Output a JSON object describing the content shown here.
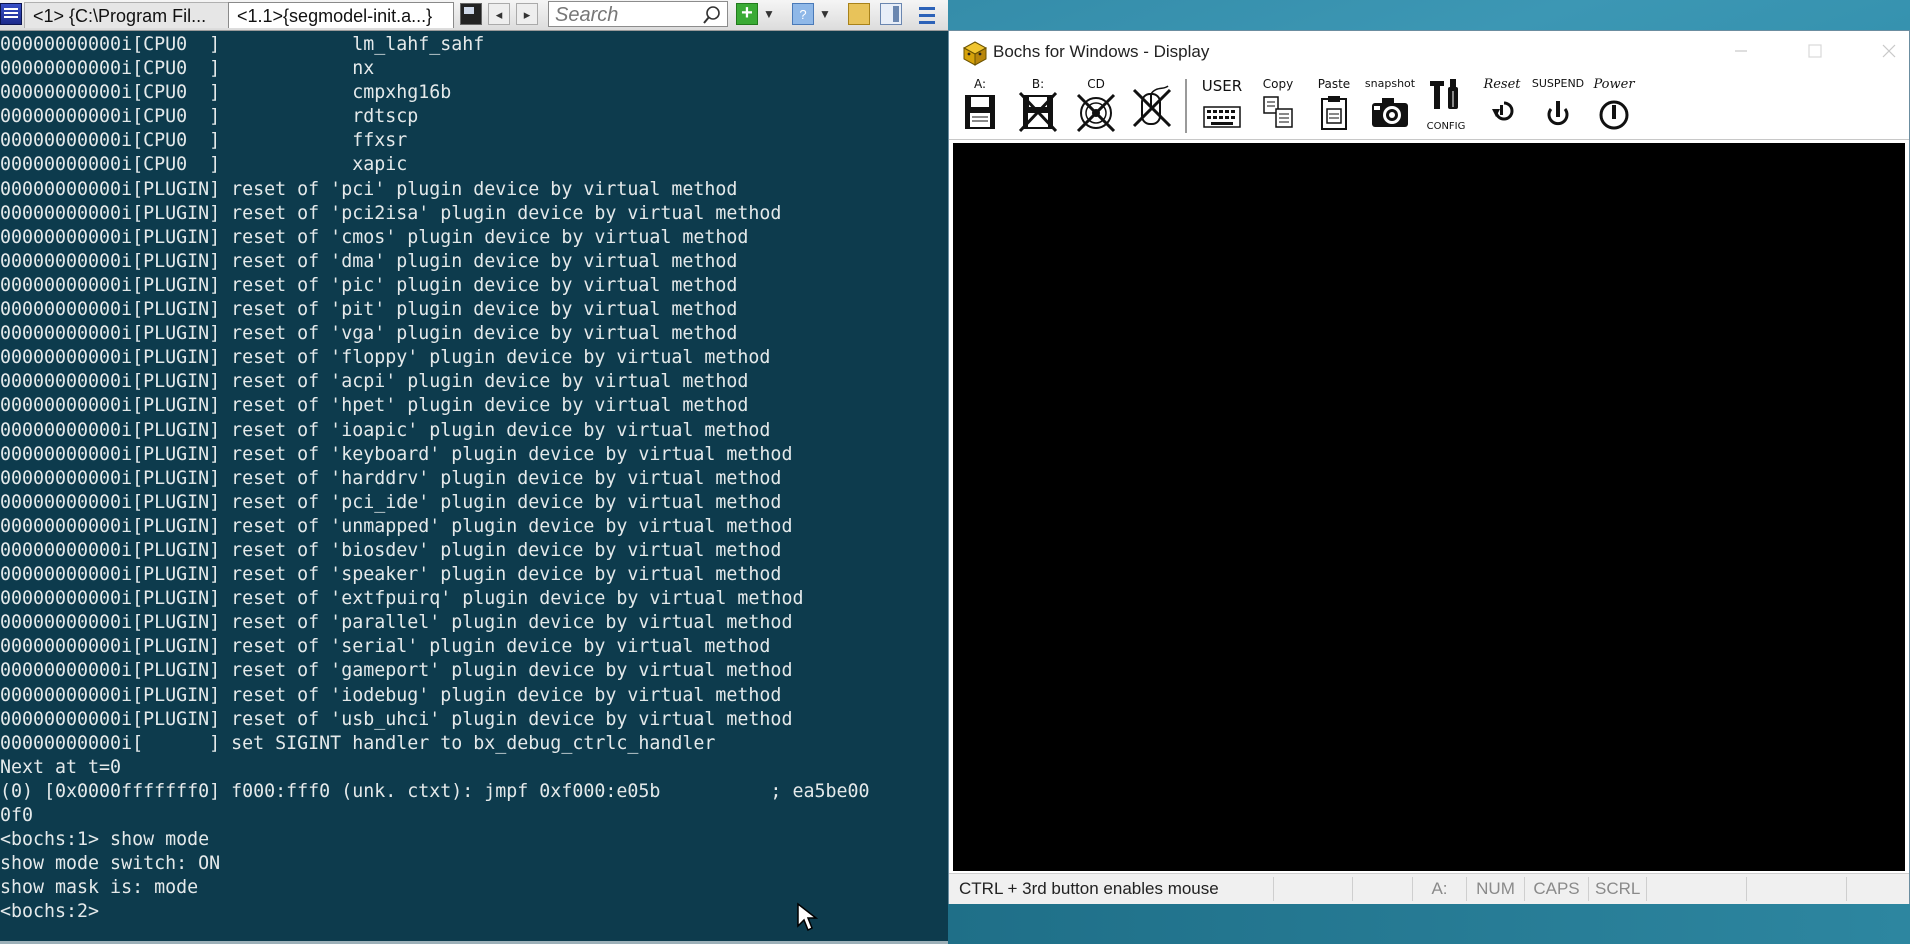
{
  "console": {
    "tabs": [
      {
        "label": "<1> {C:\\Program Fil..."
      },
      {
        "label": "<1.1>{segmodel-init.a...}"
      }
    ],
    "search": {
      "placeholder": "Search"
    },
    "lines": [
      "00000000000i[CPU0  ]            lm_lahf_sahf",
      "00000000000i[CPU0  ]            nx",
      "00000000000i[CPU0  ]            cmpxhg16b",
      "00000000000i[CPU0  ]            rdtscp",
      "00000000000i[CPU0  ]            ffxsr",
      "00000000000i[CPU0  ]            xapic",
      "00000000000i[PLUGIN] reset of 'pci' plugin device by virtual method",
      "00000000000i[PLUGIN] reset of 'pci2isa' plugin device by virtual method",
      "00000000000i[PLUGIN] reset of 'cmos' plugin device by virtual method",
      "00000000000i[PLUGIN] reset of 'dma' plugin device by virtual method",
      "00000000000i[PLUGIN] reset of 'pic' plugin device by virtual method",
      "00000000000i[PLUGIN] reset of 'pit' plugin device by virtual method",
      "00000000000i[PLUGIN] reset of 'vga' plugin device by virtual method",
      "00000000000i[PLUGIN] reset of 'floppy' plugin device by virtual method",
      "00000000000i[PLUGIN] reset of 'acpi' plugin device by virtual method",
      "00000000000i[PLUGIN] reset of 'hpet' plugin device by virtual method",
      "00000000000i[PLUGIN] reset of 'ioapic' plugin device by virtual method",
      "00000000000i[PLUGIN] reset of 'keyboard' plugin device by virtual method",
      "00000000000i[PLUGIN] reset of 'harddrv' plugin device by virtual method",
      "00000000000i[PLUGIN] reset of 'pci_ide' plugin device by virtual method",
      "00000000000i[PLUGIN] reset of 'unmapped' plugin device by virtual method",
      "00000000000i[PLUGIN] reset of 'biosdev' plugin device by virtual method",
      "00000000000i[PLUGIN] reset of 'speaker' plugin device by virtual method",
      "00000000000i[PLUGIN] reset of 'extfpuirq' plugin device by virtual method",
      "00000000000i[PLUGIN] reset of 'parallel' plugin device by virtual method",
      "00000000000i[PLUGIN] reset of 'serial' plugin device by virtual method",
      "00000000000i[PLUGIN] reset of 'gameport' plugin device by virtual method",
      "00000000000i[PLUGIN] reset of 'iodebug' plugin device by virtual method",
      "00000000000i[PLUGIN] reset of 'usb_uhci' plugin device by virtual method",
      "00000000000i[      ] set SIGINT handler to bx_debug_ctrlc_handler",
      "Next at t=0",
      "(0) [0x0000fffffff0] f000:fff0 (unk. ctxt): jmpf 0xf000:e05b          ; ea5be00",
      "0f0",
      "<bochs:1> show mode",
      "show mode switch: ON",
      "show mask is: mode",
      "<bochs:2>"
    ]
  },
  "bochs": {
    "title": "Bochs for Windows - Display",
    "toolbar": {
      "floppy_a": "A:",
      "floppy_b": "B:",
      "cdrom": "CD",
      "user": "USER",
      "copy": "Copy",
      "paste": "Paste",
      "snapshot": "snapshot",
      "config": "CONFIG",
      "reset": "Reset",
      "suspend": "SUSPEND",
      "power": "Power"
    },
    "status": {
      "message": "CTRL + 3rd button enables mouse",
      "drive_a": "A:",
      "num": "NUM",
      "caps": "CAPS",
      "scrl": "SCRL"
    }
  }
}
